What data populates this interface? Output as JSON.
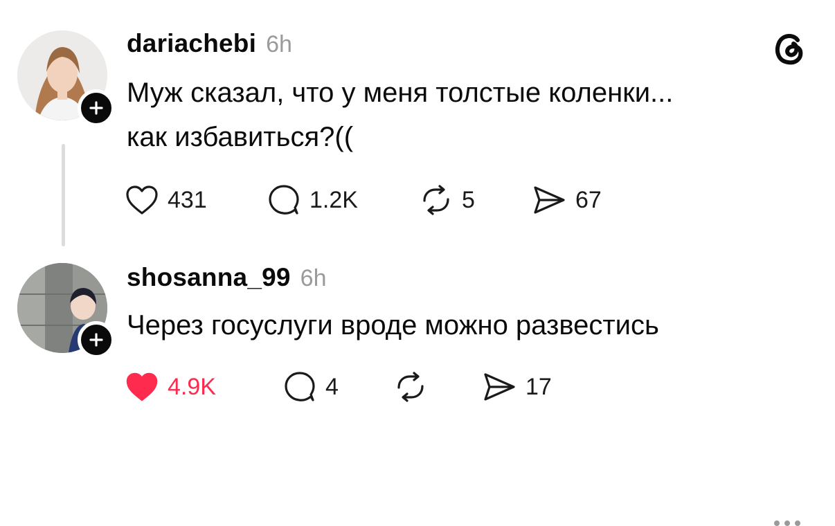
{
  "posts": [
    {
      "username": "dariachebi",
      "time": "6h",
      "text_lines": [
        "Муж сказал, что у меня толстые коленки...",
        "как избавиться?(("
      ],
      "stats": {
        "likes": "431",
        "replies": "1.2K",
        "reposts": "5",
        "shares": "67"
      },
      "liked": false
    },
    {
      "username": "shosanna_99",
      "time": "6h",
      "text_lines": [
        "Через госуслуги вроде можно развестись"
      ],
      "stats": {
        "likes": "4.9K",
        "replies": "4",
        "reposts": "",
        "shares": "17"
      },
      "liked": true
    }
  ],
  "icons": {
    "like": "heart-icon",
    "reply": "comment-icon",
    "repost": "repost-icon",
    "share": "send-icon",
    "brand": "threads-logo-icon",
    "more": "more-options-icon",
    "follow": "plus-icon"
  },
  "colors": {
    "like_active": "#ff2b4f",
    "muted": "#9a9a9a",
    "thread_line": "#dcdcdc"
  }
}
